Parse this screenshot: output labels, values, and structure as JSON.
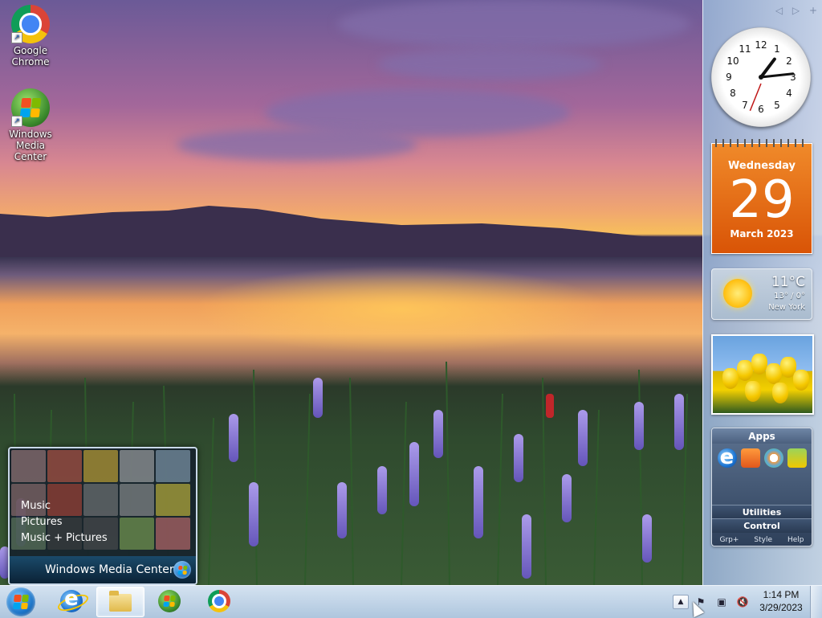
{
  "desktop": {
    "icons": [
      {
        "label": "Google Chrome",
        "icon": "chrome-icon"
      },
      {
        "label": "Windows Media Center",
        "icon": "windows-media-center-icon"
      }
    ]
  },
  "media_center_preview": {
    "menu": [
      "Music",
      "Pictures",
      "Music + Pictures"
    ],
    "title_prefix": "Windows",
    "title_suffix": " Media Center"
  },
  "sidebar": {
    "controls": [
      "◁",
      "▷",
      "+"
    ],
    "clock": {
      "hour": 1,
      "minute": 14,
      "second": 33
    },
    "calendar": {
      "weekday": "Wednesday",
      "day": "29",
      "month_year": "March 2023"
    },
    "weather": {
      "temperature": "11°C",
      "hi_lo": "13° / 0°",
      "city": "New York",
      "condition_icon": "sun-icon"
    },
    "slideshow": {
      "subject": "yellow tulips"
    },
    "apps": {
      "header": "Apps",
      "icons": [
        "internet-explorer-icon",
        "media-player-icon",
        "paint-icon",
        "trophy-icon"
      ],
      "rows": [
        "Utilities",
        "Control"
      ],
      "footer": [
        "Grp+",
        "Style",
        "Help"
      ]
    }
  },
  "taskbar": {
    "pinned": [
      "internet-explorer-icon",
      "file-explorer-icon",
      "windows-media-center-icon",
      "chrome-icon"
    ],
    "active": "file-explorer-icon",
    "tray": {
      "expand_label": "▲",
      "icons": [
        "action-center-icon",
        "network-icon",
        "volume-muted-icon"
      ]
    },
    "time": "1:14 PM",
    "date": "3/29/2023"
  },
  "colors": {
    "calendar_orange": "#e8670f",
    "taskbar_blue": "#bcd0e6",
    "sidebar_blue": "#a9bfdc"
  }
}
